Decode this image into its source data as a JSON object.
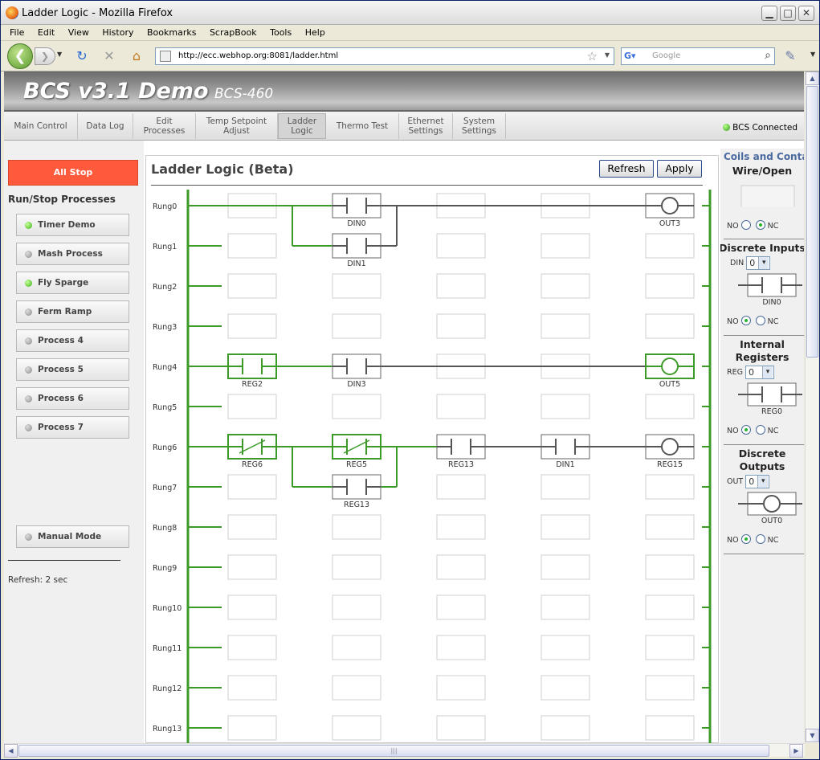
{
  "window": {
    "title": "Ladder Logic - Mozilla Firefox"
  },
  "menu": [
    "File",
    "Edit",
    "View",
    "History",
    "Bookmarks",
    "ScrapBook",
    "Tools",
    "Help"
  ],
  "nav": {
    "url": "http://ecc.webhop.org:8081/ladder.html",
    "search_placeholder": "Google"
  },
  "header": {
    "title": "BCS v3.1 Demo",
    "subtitle": "BCS-460"
  },
  "tabs": [
    {
      "label": "Main Control",
      "active": false
    },
    {
      "label": "Data Log",
      "active": false
    },
    {
      "label": "Edit\nProcesses",
      "active": false
    },
    {
      "label": "Temp Setpoint\nAdjust",
      "active": false
    },
    {
      "label": "Ladder\nLogic",
      "active": true
    },
    {
      "label": "Thermo Test",
      "active": false
    },
    {
      "label": "Ethernet\nSettings",
      "active": false
    },
    {
      "label": "System\nSettings",
      "active": false
    }
  ],
  "status": {
    "connected_label": "BCS Connected"
  },
  "sidebar": {
    "all_stop_label": "All Stop",
    "section_title": "Run/Stop Processes",
    "processes": [
      {
        "label": "Timer Demo",
        "running": true
      },
      {
        "label": "Mash Process",
        "running": false
      },
      {
        "label": "Fly Sparge",
        "running": true
      },
      {
        "label": "Ferm Ramp",
        "running": false
      },
      {
        "label": "Process 4",
        "running": false
      },
      {
        "label": "Process 5",
        "running": false
      },
      {
        "label": "Process 6",
        "running": false
      },
      {
        "label": "Process 7",
        "running": false
      }
    ],
    "manual_mode_label": "Manual Mode",
    "refresh_text": "Refresh: 2 sec"
  },
  "main": {
    "title": "Ladder Logic (Beta)",
    "refresh_button": "Refresh",
    "apply_button": "Apply",
    "rungs": [
      "Rung0",
      "Rung1",
      "Rung2",
      "Rung3",
      "Rung4",
      "Rung5",
      "Rung6",
      "Rung7",
      "Rung8",
      "Rung9",
      "Rung10",
      "Rung11",
      "Rung12",
      "Rung13"
    ],
    "elements": [
      {
        "rung": 0,
        "col": 2,
        "type": "contact-no",
        "label": "DIN0",
        "active": false
      },
      {
        "rung": 0,
        "col": 6,
        "type": "coil",
        "label": "OUT3",
        "active": false
      },
      {
        "rung": 1,
        "col": 2,
        "type": "contact-no",
        "label": "DIN1",
        "active": false
      },
      {
        "rung": 4,
        "col": 1,
        "type": "contact-no",
        "label": "REG2",
        "active": true
      },
      {
        "rung": 4,
        "col": 2,
        "type": "contact-no",
        "label": "DIN3",
        "active": false
      },
      {
        "rung": 4,
        "col": 6,
        "type": "coil",
        "label": "OUT5",
        "active": true
      },
      {
        "rung": 6,
        "col": 1,
        "type": "contact-nc",
        "label": "REG6",
        "active": true
      },
      {
        "rung": 6,
        "col": 2,
        "type": "contact-nc",
        "label": "REG5",
        "active": true
      },
      {
        "rung": 6,
        "col": 3,
        "type": "contact-no",
        "label": "REG13",
        "active": false
      },
      {
        "rung": 6,
        "col": 4,
        "type": "contact-no",
        "label": "DIN1",
        "active": false
      },
      {
        "rung": 6,
        "col": 6,
        "type": "coil",
        "label": "REG15",
        "active": false
      },
      {
        "rung": 7,
        "col": 2,
        "type": "contact-no",
        "label": "REG13",
        "active": false
      }
    ]
  },
  "palette": {
    "title": "Coils and Contacts",
    "no_label": "NO",
    "nc_label": "NC",
    "wire": {
      "heading": "Wire/Open",
      "nc_selected": true
    },
    "discrete_inputs": {
      "heading": "Discrete Inputs",
      "prefix": "DIN",
      "value": "0",
      "symbol_label": "DIN0",
      "no_selected": true
    },
    "internal_registers": {
      "heading_line1": "Internal",
      "heading_line2": "Registers",
      "prefix": "REG",
      "value": "0",
      "symbol_label": "REG0",
      "no_selected": true
    },
    "discrete_outputs": {
      "heading_line1": "Discrete",
      "heading_line2": "Outputs",
      "prefix": "OUT",
      "value": "0",
      "symbol_label": "OUT0",
      "no_selected": true
    }
  },
  "colors": {
    "energized": "#3c9a28",
    "wire": "#555555",
    "all_stop": "#ff5a3c"
  }
}
